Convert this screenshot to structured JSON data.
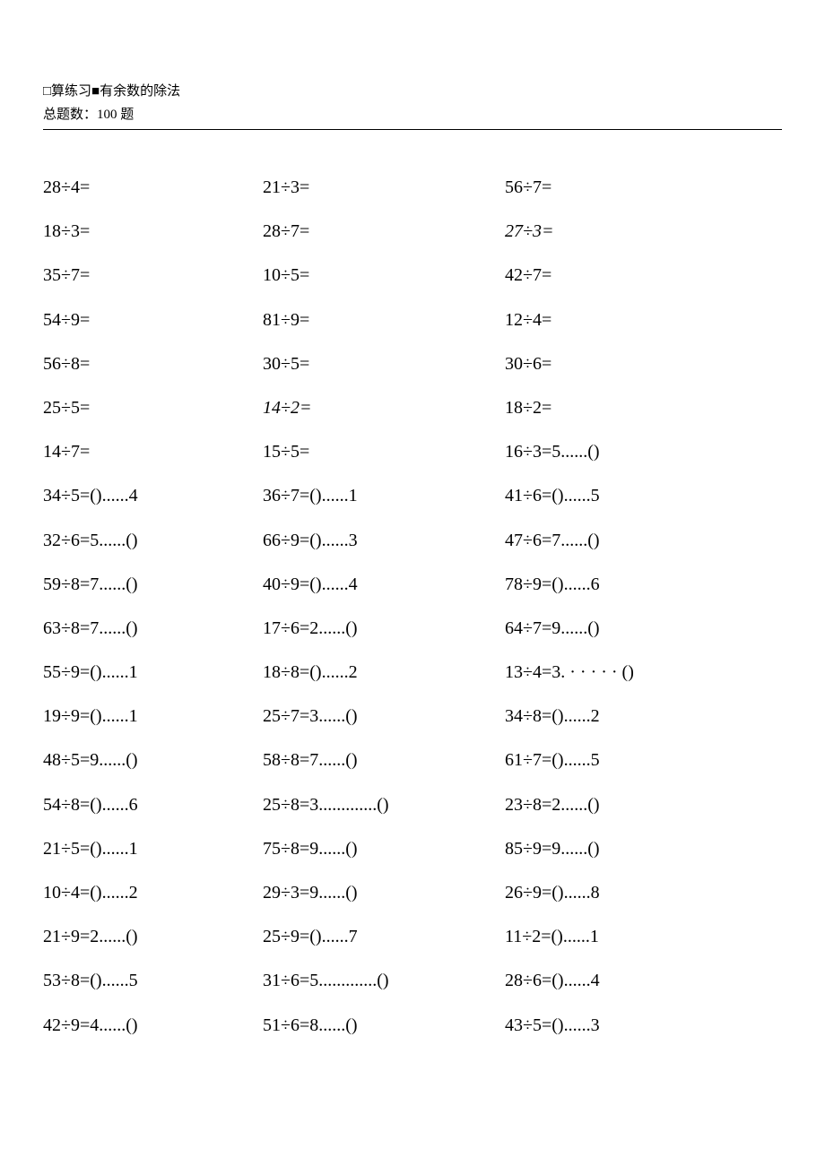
{
  "header": {
    "line1": "□算练习■有余数的除法",
    "line2": "总题数：100 题"
  },
  "rows": [
    [
      {
        "t": "28÷4="
      },
      {
        "t": "21÷3="
      },
      {
        "t": "56÷7="
      }
    ],
    [
      {
        "t": "18÷3="
      },
      {
        "t": "28÷7="
      },
      {
        "t": "27÷3=",
        "style": "italic"
      }
    ],
    [
      {
        "t": "35÷7="
      },
      {
        "t": "10÷5="
      },
      {
        "t": "42÷7="
      }
    ],
    [
      {
        "t": "54÷9="
      },
      {
        "t": "81÷9="
      },
      {
        "t": "12÷4="
      }
    ],
    [
      {
        "t": "56÷8="
      },
      {
        "t": "30÷5="
      },
      {
        "t": "30÷6="
      }
    ],
    [
      {
        "t": "25÷5="
      },
      {
        "t": "14÷2=",
        "style": "italic"
      },
      {
        "t": "18÷2="
      }
    ],
    [
      {
        "t": "14÷7="
      },
      {
        "t": "15÷5="
      },
      {
        "t": "16÷3=5......()"
      }
    ],
    [
      {
        "t": "34÷5=()......4"
      },
      {
        "t": "36÷7=()......1"
      },
      {
        "t": "41÷6=()......5"
      }
    ],
    [
      {
        "t": "32÷6=5......()"
      },
      {
        "t": "66÷9=()......3"
      },
      {
        "t": "47÷6=7......()"
      }
    ],
    [
      {
        "t": "59÷8=7......()"
      },
      {
        "t": "40÷9=()......4"
      },
      {
        "t": "78÷9=()......6"
      }
    ],
    [
      {
        "t": "63÷8=7......()"
      },
      {
        "t": "17÷6=2......()"
      },
      {
        "t": "64÷7=9......()"
      }
    ],
    [
      {
        "t": "55÷9=()......1"
      },
      {
        "t": "18÷8=()......2"
      },
      {
        "t": "13÷4=3.  ·  ·  ·  ·  · ()"
      }
    ],
    [
      {
        "t": "19÷9=()......1"
      },
      {
        "t": "25÷7=3......()"
      },
      {
        "t": "34÷8=()......2"
      }
    ],
    [
      {
        "t": "48÷5=9......()"
      },
      {
        "t": "58÷8=7......()"
      },
      {
        "t": "61÷7=()......5"
      }
    ],
    [
      {
        "t": "54÷8=()......6"
      },
      {
        "t": "25÷8=3.............()"
      },
      {
        "t": "23÷8=2......()"
      }
    ],
    [
      {
        "t": "21÷5=()......1"
      },
      {
        "t": "75÷8=9......()"
      },
      {
        "t": "85÷9=9......()"
      }
    ],
    [
      {
        "t": "10÷4=()......2"
      },
      {
        "t": "29÷3=9......()"
      },
      {
        "t": "26÷9=()......8"
      }
    ],
    [
      {
        "t": "21÷9=2......()"
      },
      {
        "t": "25÷9=()......7"
      },
      {
        "t": "11÷2=()......1"
      }
    ],
    [
      {
        "t": "53÷8=()......5"
      },
      {
        "t": "31÷6=5.............()"
      },
      {
        "t": "28÷6=()......4"
      }
    ],
    [
      {
        "t": "42÷9=4......()"
      },
      {
        "t": "51÷6=8......()"
      },
      {
        "t": "43÷5=()......3"
      }
    ]
  ]
}
